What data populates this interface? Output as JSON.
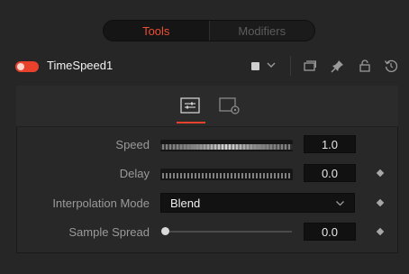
{
  "tabs": {
    "tools_label": "Tools",
    "modifiers_label": "Modifiers",
    "active": "Tools"
  },
  "tool": {
    "name": "TimeSpeed1",
    "enabled": true
  },
  "accent_color": "#e8422c",
  "header_icons": [
    "color-chip-icon",
    "chevron-down-icon",
    "version-icon",
    "pin-icon",
    "lock-icon",
    "reset-icon"
  ],
  "control_tabs": [
    {
      "icon": "sliders-icon",
      "active": true
    },
    {
      "icon": "settings-icon",
      "active": false
    }
  ],
  "controls": {
    "speed": {
      "label": "Speed",
      "value": "1.0"
    },
    "delay": {
      "label": "Delay",
      "value": "0.0"
    },
    "interpolation": {
      "label": "Interpolation Mode",
      "value": "Blend"
    },
    "sample_spread": {
      "label": "Sample Spread",
      "value": "0.0",
      "fraction": 0.0
    }
  }
}
